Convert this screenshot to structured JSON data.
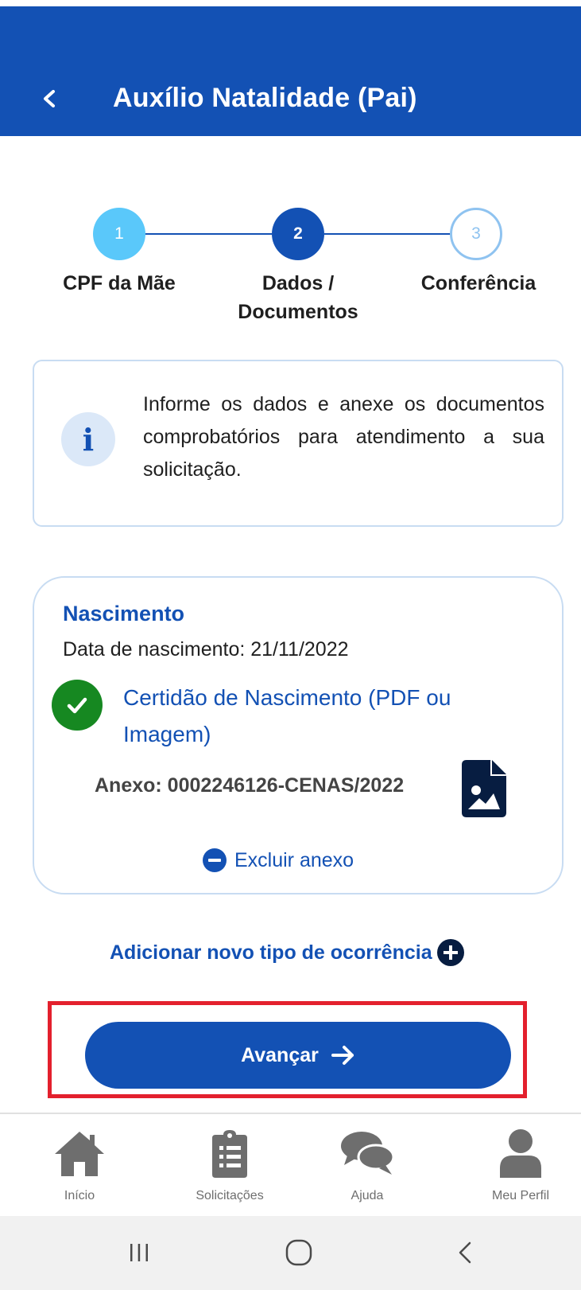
{
  "header": {
    "title": "Auxílio Natalidade (Pai)",
    "back_icon": "chevron-left-icon",
    "background_color": "#1351b4"
  },
  "stepper": {
    "steps": [
      {
        "number": "1",
        "label": "CPF da Mãe",
        "state": "completed"
      },
      {
        "number": "2",
        "label_line1": "Dados /",
        "label_line2": "Documentos",
        "state": "current"
      },
      {
        "number": "3",
        "label": "Conferência",
        "state": "pending"
      }
    ]
  },
  "info": {
    "icon": "info-icon",
    "text": "Informe os dados e anexe os documentos comprobatórios para atendimento a sua solicitação."
  },
  "occurrence": {
    "title": "Nascimento",
    "date_text": "Data de nascimento: 21/11/2022",
    "document_status_icon": "check-circle-icon",
    "document_link": "Certidão de Nascimento (PDF ou Imagem)",
    "attachment_text": "Anexo: 0002246126-CENAS/2022",
    "attachment_icon": "image-file-icon",
    "delete_label": "Excluir anexo"
  },
  "actions": {
    "add_occurrence_label": "Adicionar novo tipo de ocorrência",
    "advance_label": "Avançar",
    "highlight_color": "#e3202d"
  },
  "bottom_nav": {
    "items": [
      {
        "label": "Início",
        "icon": "home-icon"
      },
      {
        "label": "Solicitações",
        "icon": "clipboard-icon"
      },
      {
        "label": "Ajuda",
        "icon": "chat-bubbles-icon"
      },
      {
        "label": "Meu Perfil",
        "icon": "user-icon"
      }
    ]
  },
  "system_nav": {
    "buttons": [
      "recent-apps-icon",
      "home-circle-icon",
      "back-chevron-icon"
    ]
  }
}
